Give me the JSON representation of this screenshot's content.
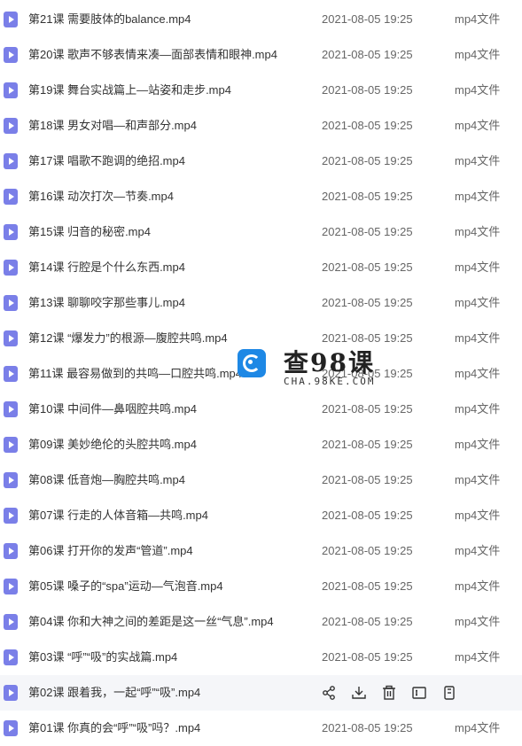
{
  "files": [
    {
      "name": "第21课 需要肢体的balance.mp4",
      "date": "2021-08-05 19:25",
      "type": "mp4文件"
    },
    {
      "name": "第20课 歌声不够表情来凑—面部表情和眼神.mp4",
      "date": "2021-08-05 19:25",
      "type": "mp4文件"
    },
    {
      "name": "第19课 舞台实战篇上—站姿和走步.mp4",
      "date": "2021-08-05 19:25",
      "type": "mp4文件"
    },
    {
      "name": "第18课 男女对唱—和声部分.mp4",
      "date": "2021-08-05 19:25",
      "type": "mp4文件"
    },
    {
      "name": "第17课 唱歌不跑调的绝招.mp4",
      "date": "2021-08-05 19:25",
      "type": "mp4文件"
    },
    {
      "name": "第16课 动次打次—节奏.mp4",
      "date": "2021-08-05 19:25",
      "type": "mp4文件"
    },
    {
      "name": "第15课 归音的秘密.mp4",
      "date": "2021-08-05 19:25",
      "type": "mp4文件"
    },
    {
      "name": "第14课 行腔是个什么东西.mp4",
      "date": "2021-08-05 19:25",
      "type": "mp4文件"
    },
    {
      "name": "第13课 聊聊咬字那些事儿.mp4",
      "date": "2021-08-05 19:25",
      "type": "mp4文件"
    },
    {
      "name": "第12课 “爆发力”的根源—腹腔共鸣.mp4",
      "date": "2021-08-05 19:25",
      "type": "mp4文件"
    },
    {
      "name": "第11课 最容易做到的共鸣—口腔共鸣.mp4",
      "date": "2021-08-05 19:25",
      "type": "mp4文件"
    },
    {
      "name": "第10课 中间件—鼻咽腔共鸣.mp4",
      "date": "2021-08-05 19:25",
      "type": "mp4文件"
    },
    {
      "name": "第09课 美妙绝伦的头腔共鸣.mp4",
      "date": "2021-08-05 19:25",
      "type": "mp4文件"
    },
    {
      "name": "第08课 低音炮—胸腔共鸣.mp4",
      "date": "2021-08-05 19:25",
      "type": "mp4文件"
    },
    {
      "name": "第07课 行走的人体音箱—共鸣.mp4",
      "date": "2021-08-05 19:25",
      "type": "mp4文件"
    },
    {
      "name": "第06课 打开你的发声“管道”.mp4",
      "date": "2021-08-05 19:25",
      "type": "mp4文件"
    },
    {
      "name": "第05课 嗓子的“spa”运动—气泡音.mp4",
      "date": "2021-08-05 19:25",
      "type": "mp4文件"
    },
    {
      "name": "第04课 你和大神之间的差距是这一丝“气息”.mp4",
      "date": "2021-08-05 19:25",
      "type": "mp4文件"
    },
    {
      "name": "第03课 “呼”“吸”的实战篇.mp4",
      "date": "2021-08-05 19:25",
      "type": "mp4文件"
    },
    {
      "name": "第02课 跟着我，一起“呼”“吸”.mp4",
      "date": "",
      "type": ""
    },
    {
      "name": "第01课 你真的会“呼”“吸”吗？.mp4",
      "date": "2021-08-05 19:25",
      "type": "mp4文件"
    }
  ],
  "hover_row_index": 19,
  "hover_actions": [
    "share-icon",
    "download-icon",
    "delete-icon",
    "rename-icon",
    "copy-icon"
  ],
  "watermark": {
    "title": "查98课",
    "subtitle": "CHA.98KE.COM"
  },
  "colors": {
    "file_icon": "#7a7fe8",
    "hover_bg": "#f5f6f9",
    "watermark_logo": "#1e88e5"
  }
}
